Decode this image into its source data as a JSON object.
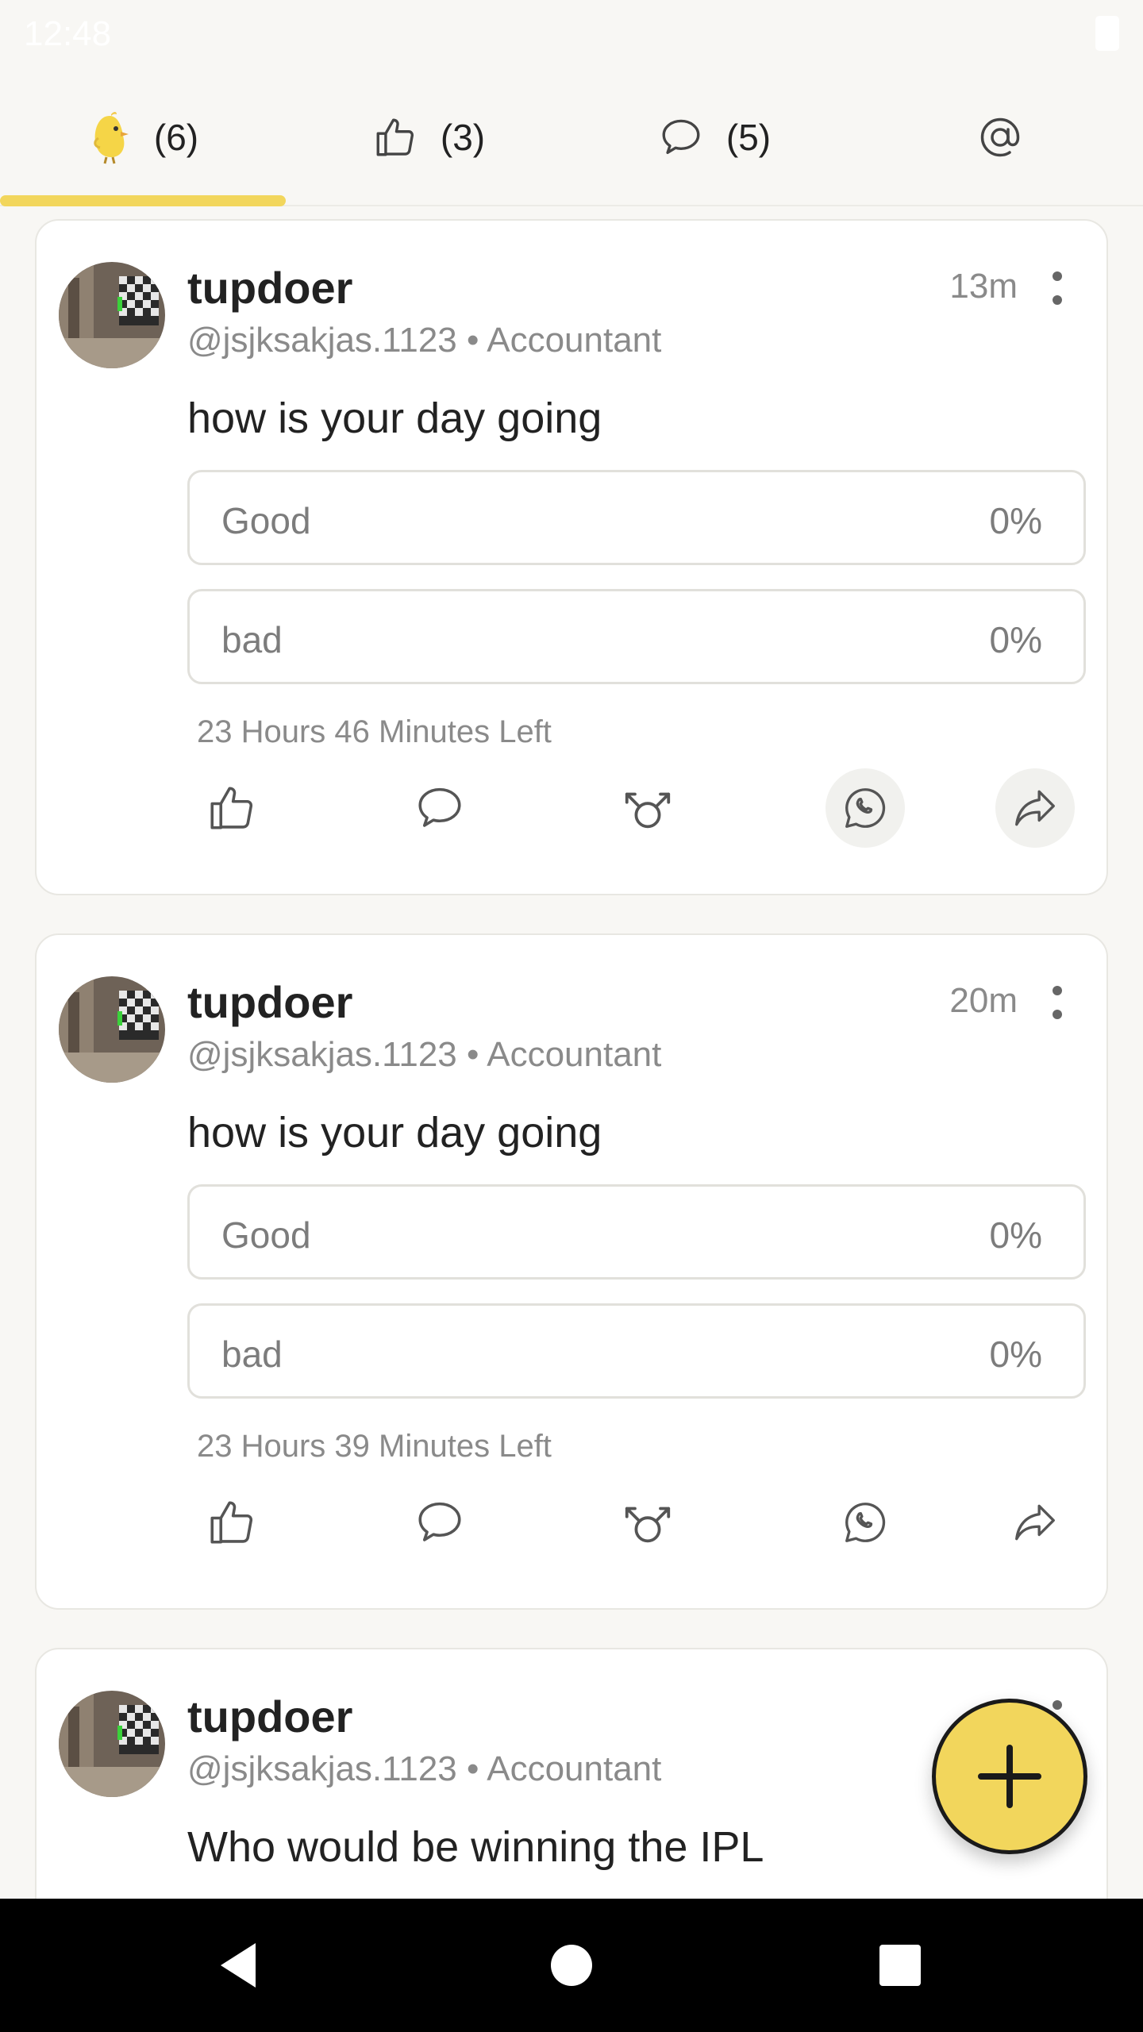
{
  "status_bar": {
    "time": "12:48"
  },
  "tabs": [
    {
      "icon": "chick-icon",
      "count": "(6)",
      "active": true
    },
    {
      "icon": "thumbs-up-icon",
      "count": "(3)"
    },
    {
      "icon": "comment-icon",
      "count": "(5)"
    },
    {
      "icon": "at-sign-icon",
      "count": ""
    }
  ],
  "colors": {
    "accent": "#f2d65c",
    "background": "#f8f7f4",
    "card": "#ffffff"
  },
  "posts": [
    {
      "author": "tupdoer",
      "handle": "@jsjksakjas.1123",
      "separator": "•",
      "role": "Accountant",
      "time": "13m",
      "text": "how is your day going",
      "options": [
        {
          "label": "Good",
          "percent": "0%"
        },
        {
          "label": "bad",
          "percent": "0%"
        }
      ],
      "time_left": "23 Hours 46 Minutes Left"
    },
    {
      "author": "tupdoer",
      "handle": "@jsjksakjas.1123",
      "separator": "•",
      "role": "Accountant",
      "time": "20m",
      "text": "how is your day going",
      "options": [
        {
          "label": "Good",
          "percent": "0%"
        },
        {
          "label": "bad",
          "percent": "0%"
        }
      ],
      "time_left": "23 Hours 39 Minutes Left"
    },
    {
      "author": "tupdoer",
      "handle": "@jsjksakjas.1123",
      "separator": "•",
      "role": "Accountant",
      "text": "Who would be winning the IPL"
    }
  ],
  "actions": [
    "thumbs-up-icon",
    "comment-icon",
    "gender-icon",
    "whatsapp-icon",
    "share-icon"
  ],
  "fab": {
    "icon": "plus-icon"
  },
  "nav": [
    "back-icon",
    "home-icon",
    "recents-icon"
  ]
}
